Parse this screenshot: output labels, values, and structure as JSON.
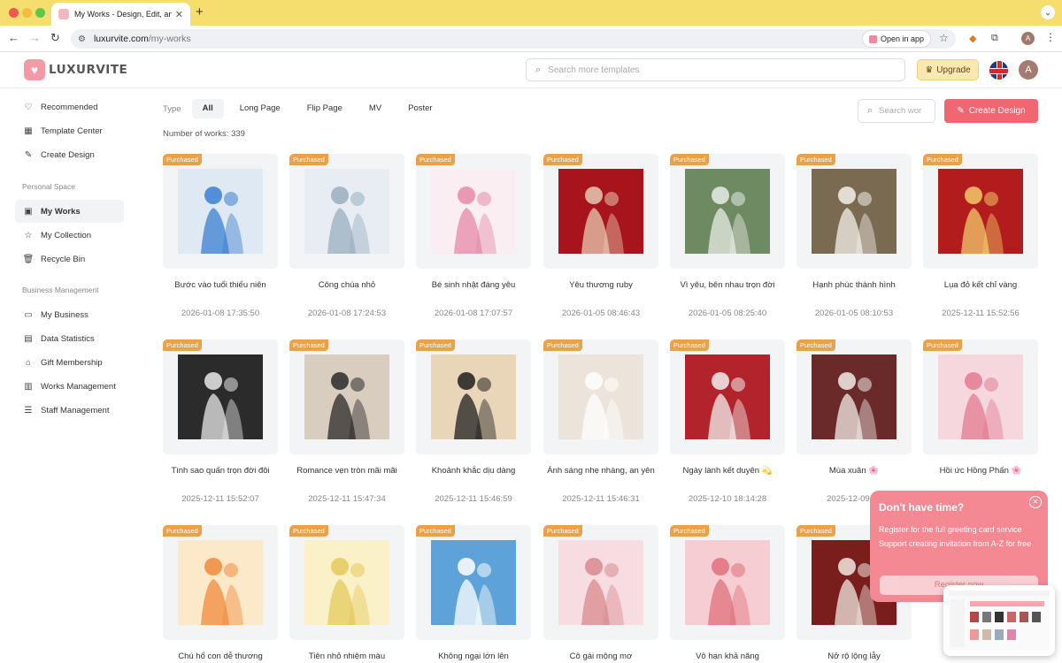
{
  "browser": {
    "tab_title": "My Works - Design, Edit, and",
    "url_host": "luxurvite.com",
    "url_path": "/my-works",
    "open_in_app": "Open in app",
    "profile_letter": "A"
  },
  "header": {
    "logo_text": "LUXURVITE",
    "search_placeholder": "Search more templates",
    "upgrade_label": "Upgrade",
    "avatar_letter": "A"
  },
  "sidebar": {
    "items_top": [
      {
        "label": "Recommended",
        "icon": "heart-icon"
      },
      {
        "label": "Template Center",
        "icon": "grid-icon"
      },
      {
        "label": "Create Design",
        "icon": "edit-icon"
      }
    ],
    "group1": "Personal Space",
    "items_personal": [
      {
        "label": "My Works",
        "icon": "image-icon",
        "active": true
      },
      {
        "label": "My Collection",
        "icon": "star-icon"
      },
      {
        "label": "Recycle Bin",
        "icon": "trash-icon"
      }
    ],
    "group2": "Business Management",
    "items_business": [
      {
        "label": "My Business",
        "icon": "briefcase-icon"
      },
      {
        "label": "Data Statistics",
        "icon": "chart-icon"
      },
      {
        "label": "Gift Membership",
        "icon": "gift-icon"
      },
      {
        "label": "Works Management",
        "icon": "book-icon"
      },
      {
        "label": "Staff Management",
        "icon": "users-icon"
      }
    ]
  },
  "filters": {
    "type_label": "Type",
    "types": [
      "All",
      "Long Page",
      "Flip Page",
      "MV",
      "Poster"
    ],
    "count_text": "Number of works: 339",
    "search_placeholder": "Search wor",
    "create_label": "Create Design"
  },
  "works": [
    {
      "badge": "Purchased",
      "name": "Bước vào tuổi thiếu niên",
      "date": "2026-01-08 17:35:50",
      "bg": "#dfe9f3",
      "fg": "#3b7fd1"
    },
    {
      "badge": "Purchased",
      "name": "Công chúa nhỏ",
      "date": "2026-01-08 17:24:53",
      "bg": "#e7edf2",
      "fg": "#9aaec0"
    },
    {
      "badge": "Purchased",
      "name": "Bé sinh nhật đáng yêu",
      "date": "2026-01-08 17:07:57",
      "bg": "#fbeef3",
      "fg": "#e58aa8"
    },
    {
      "badge": "Purchased",
      "name": "Yêu thương ruby",
      "date": "2026-01-05 08:46:43",
      "bg": "#a8141b",
      "fg": "#e8c9b4"
    },
    {
      "badge": "Purchased",
      "name": "Vì yêu, bên nhau trọn đời",
      "date": "2026-01-05 08:25:40",
      "bg": "#6e8a62",
      "fg": "#e8ece6"
    },
    {
      "badge": "Purchased",
      "name": "Hạnh phúc thành hình",
      "date": "2026-01-05 08:10:53",
      "bg": "#7a6a52",
      "fg": "#f4f0ea"
    },
    {
      "badge": "Purchased",
      "name": "Lụa đỏ kết chỉ vàng",
      "date": "2025-12-11 15:52:56",
      "bg": "#b21c1c",
      "fg": "#f2c96b"
    },
    {
      "badge": "Purchased",
      "name": "Tình sao quấn trọn đời đôi",
      "date": "2025-12-11 15:52:07",
      "bg": "#2b2b2b",
      "fg": "#e9e9e9"
    },
    {
      "badge": "Purchased",
      "name": "Romance vẹn tròn mãi mãi",
      "date": "2025-12-11 15:47:34",
      "bg": "#d9cdc0",
      "fg": "#2a2a2a"
    },
    {
      "badge": "Purchased",
      "name": "Khoảnh khắc dịu dàng",
      "date": "2025-12-11 15:46:59",
      "bg": "#e9d5b7",
      "fg": "#1f1f1f"
    },
    {
      "badge": "Purchased",
      "name": "Ánh sáng nhẹ nhàng, an yên",
      "date": "2025-12-11 15:46:31",
      "bg": "#ece3da",
      "fg": "#ffffff"
    },
    {
      "badge": "Purchased",
      "name": "Ngày lành kết duyên 💫",
      "date": "2025-12-10 18:14:28",
      "bg": "#b3232c",
      "fg": "#f3f0ee"
    },
    {
      "badge": "Purchased",
      "name": "Mùa xuân 🌸",
      "date": "2025-12-09 20",
      "bg": "#6b2a2a",
      "fg": "#f2ece6"
    },
    {
      "badge": "Purchased",
      "name": "Hồi ức Hồng Phấn 🌸",
      "date": "",
      "bg": "#f6d7de",
      "fg": "#e37b92"
    },
    {
      "badge": "Purchased",
      "name": "Chú hổ con dễ thương",
      "date": "",
      "bg": "#fbe9c9",
      "fg": "#f08a3c"
    },
    {
      "badge": "Purchased",
      "name": "Tiên nhỏ nhiệm màu",
      "date": "",
      "bg": "#fbf1c8",
      "fg": "#e3c95c"
    },
    {
      "badge": "Purchased",
      "name": "Không ngại lớn lên",
      "date": "",
      "bg": "#5da2d8",
      "fg": "#ffffff"
    },
    {
      "badge": "Purchased",
      "name": "Cô gái mộng mơ",
      "date": "",
      "bg": "#f7dde2",
      "fg": "#d9898f"
    },
    {
      "badge": "Purchased",
      "name": "Vô hạn khả năng",
      "date": "",
      "bg": "#f6cdd2",
      "fg": "#e0707c"
    },
    {
      "badge": "Purchased",
      "name": "Nở rộ lộng lẫy",
      "date": "",
      "bg": "#7a1d1d",
      "fg": "#f2e8e0"
    }
  ],
  "popup": {
    "title": "Don't have time?",
    "line1": "Register for the full greeting card service",
    "line2": "Support creating invitation from A-Z for free",
    "button": "Register now"
  },
  "colors": {
    "accent": "#f06671",
    "badge": "#e9a24a",
    "popup": "#f48993",
    "tabbar": "#f5dd6e"
  }
}
